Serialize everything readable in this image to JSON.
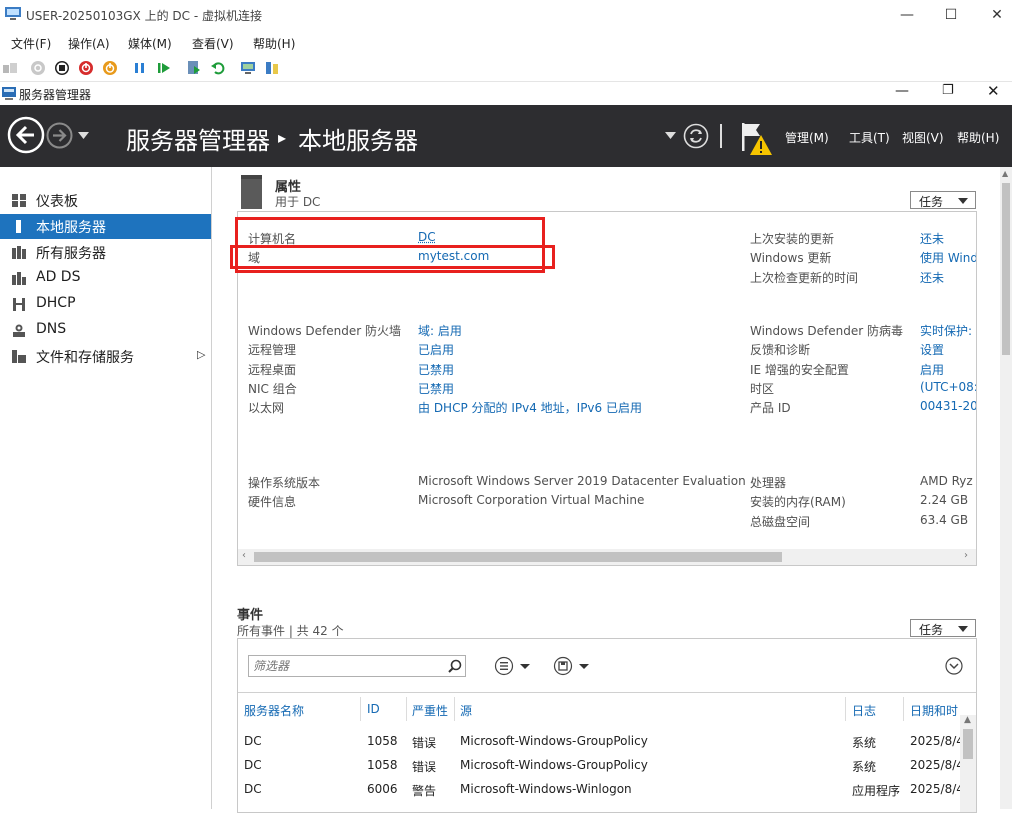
{
  "vm_window": {
    "title": "USER-20250103GX 上的 DC - 虚拟机连接",
    "controls": {
      "minimize": "—",
      "maximize": "☐",
      "close": "✕"
    }
  },
  "vm_menu": [
    "文件(F)",
    "操作(A)",
    "媒体(M)",
    "查看(V)",
    "帮助(H)"
  ],
  "sm_window": {
    "title": "服务器管理器"
  },
  "header": {
    "app_title": "服务器管理器",
    "separator": "▸",
    "page_title": "本地服务器",
    "menu": {
      "manage": "管理(M)",
      "tools": "工具(T)",
      "view": "视图(V)",
      "help": "帮助(H)"
    }
  },
  "sidebar": {
    "items": [
      {
        "label": "仪表板",
        "icon": "dashboard-icon"
      },
      {
        "label": "本地服务器",
        "icon": "local-server-icon",
        "active": true
      },
      {
        "label": "所有服务器",
        "icon": "all-servers-icon"
      },
      {
        "label": "AD DS",
        "icon": "ad-ds-icon"
      },
      {
        "label": "DHCP",
        "icon": "dhcp-icon"
      },
      {
        "label": "DNS",
        "icon": "dns-icon"
      },
      {
        "label": "文件和存储服务",
        "icon": "file-storage-icon",
        "expander": "▷"
      }
    ]
  },
  "properties": {
    "title": "属性",
    "subtitle": "用于 DC",
    "tasks_label": "任务",
    "left": [
      {
        "label": "计算机名",
        "value": "DC"
      },
      {
        "label": "域",
        "value": "mytest.com"
      },
      {
        "label": "Windows Defender 防火墙",
        "value": "域: 启用"
      },
      {
        "label": "远程管理",
        "value": "已启用"
      },
      {
        "label": "远程桌面",
        "value": "已禁用"
      },
      {
        "label": "NIC 组合",
        "value": "已禁用"
      },
      {
        "label": "以太网",
        "value": "由 DHCP 分配的 IPv4 地址，IPv6 已启用"
      },
      {
        "label": "操作系统版本",
        "value": "Microsoft Windows Server 2019 Datacenter Evaluation"
      },
      {
        "label": "硬件信息",
        "value": "Microsoft Corporation Virtual Machine"
      }
    ],
    "right": [
      {
        "label": "上次安装的更新",
        "value": "还未"
      },
      {
        "label": "Windows 更新",
        "value": "使用 Wind"
      },
      {
        "label": "上次检查更新的时间",
        "value": "还未"
      },
      {
        "label": "Windows Defender 防病毒",
        "value": "实时保护:"
      },
      {
        "label": "反馈和诊断",
        "value": "设置"
      },
      {
        "label": "IE 增强的安全配置",
        "value": "启用"
      },
      {
        "label": "时区",
        "value": "(UTC+08:"
      },
      {
        "label": "产品 ID",
        "value": "00431-20"
      },
      {
        "label": "处理器",
        "value": "AMD Ryz"
      },
      {
        "label": "安装的内存(RAM)",
        "value": "2.24 GB"
      },
      {
        "label": "总磁盘空间",
        "value": "63.4 GB"
      }
    ]
  },
  "events": {
    "title": "事件",
    "subtitle": "所有事件 | 共 42 个",
    "tasks_label": "任务",
    "filter_placeholder": "筛选器",
    "columns": [
      "服务器名称",
      "ID",
      "严重性",
      "源",
      "日志",
      "日期和时"
    ],
    "rows": [
      [
        "DC",
        "1058",
        "错误",
        "Microsoft-Windows-GroupPolicy",
        "系统",
        "2025/8/4"
      ],
      [
        "DC",
        "1058",
        "错误",
        "Microsoft-Windows-GroupPolicy",
        "系统",
        "2025/8/4"
      ],
      [
        "DC",
        "6006",
        "警告",
        "Microsoft-Windows-Winlogon",
        "应用程序",
        "2025/8/4"
      ]
    ]
  },
  "colors": {
    "header_bg": "#2d2d30",
    "accent": "#1e73be",
    "link": "#1469b3",
    "highlight_box": "#e8201e",
    "warning": "#f5c400"
  }
}
